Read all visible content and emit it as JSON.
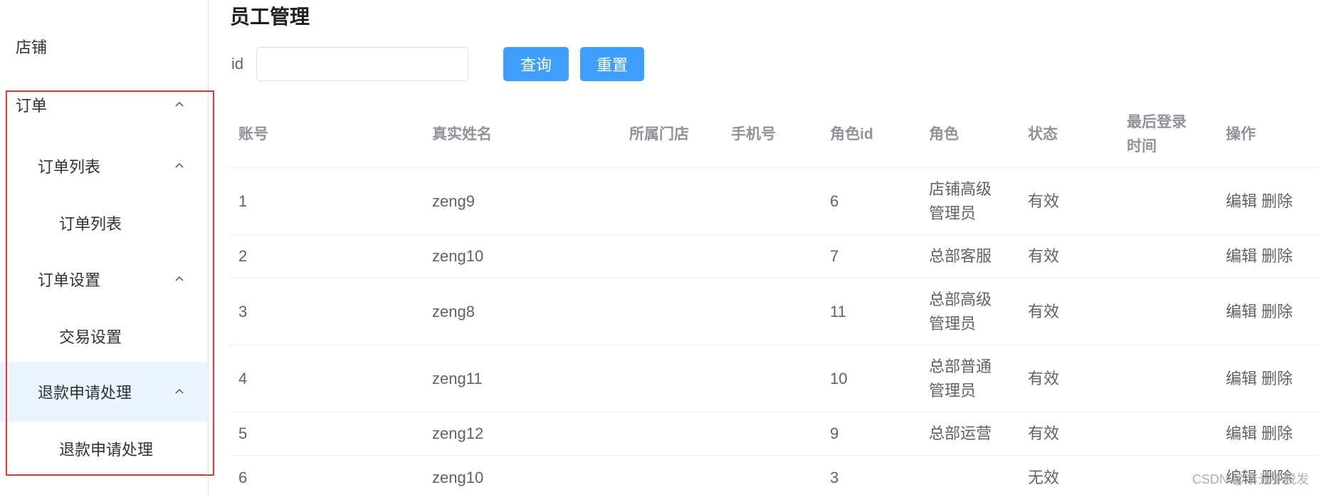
{
  "sidebar": {
    "items": [
      {
        "label": "店铺"
      },
      {
        "label": "订单"
      },
      {
        "label": "订单列表"
      },
      {
        "label": "订单列表"
      },
      {
        "label": "订单设置"
      },
      {
        "label": "交易设置"
      },
      {
        "label": "退款申请处理"
      },
      {
        "label": "退款申请处理"
      }
    ]
  },
  "main": {
    "title": "员工管理",
    "search": {
      "label": "id",
      "value": "",
      "placeholder": ""
    },
    "buttons": {
      "query": "查询",
      "reset": "重置"
    },
    "table": {
      "headers": [
        "账号",
        "真实姓名",
        "所属门店",
        "手机号",
        "角色id",
        "角色",
        "状态",
        "最后登录时间",
        "操作"
      ],
      "rows": [
        {
          "account": "1",
          "name": "zeng9",
          "store": "",
          "phone": "",
          "role_id": "6",
          "role": "店铺高级管理员",
          "status": "有效",
          "last_login": "",
          "edit": "编辑",
          "delete": "删除"
        },
        {
          "account": "2",
          "name": "zeng10",
          "store": "",
          "phone": "",
          "role_id": "7",
          "role": "总部客服",
          "status": "有效",
          "last_login": "",
          "edit": "编辑",
          "delete": "删除"
        },
        {
          "account": "3",
          "name": "zeng8",
          "store": "",
          "phone": "",
          "role_id": "11",
          "role": "总部高级管理员",
          "status": "有效",
          "last_login": "",
          "edit": "编辑",
          "delete": "删除"
        },
        {
          "account": "4",
          "name": "zeng11",
          "store": "",
          "phone": "",
          "role_id": "10",
          "role": "总部普通管理员",
          "status": "有效",
          "last_login": "",
          "edit": "编辑",
          "delete": "删除"
        },
        {
          "account": "5",
          "name": "zeng12",
          "store": "",
          "phone": "",
          "role_id": "9",
          "role": "总部运营",
          "status": "有效",
          "last_login": "",
          "edit": "编辑",
          "delete": "删除"
        },
        {
          "account": "6",
          "name": "zeng10",
          "store": "",
          "phone": "",
          "role_id": "3",
          "role": "",
          "status": "无效",
          "last_login": "",
          "edit": "编辑",
          "delete": "删除"
        }
      ]
    }
  },
  "watermark": "CSDN @李元不脱发",
  "colors": {
    "primary": "#409eff",
    "highlight_border": "#e53935",
    "active_menu_bg": "#ecf5ff"
  },
  "icons": {
    "chevron": "chevron-up-icon"
  }
}
